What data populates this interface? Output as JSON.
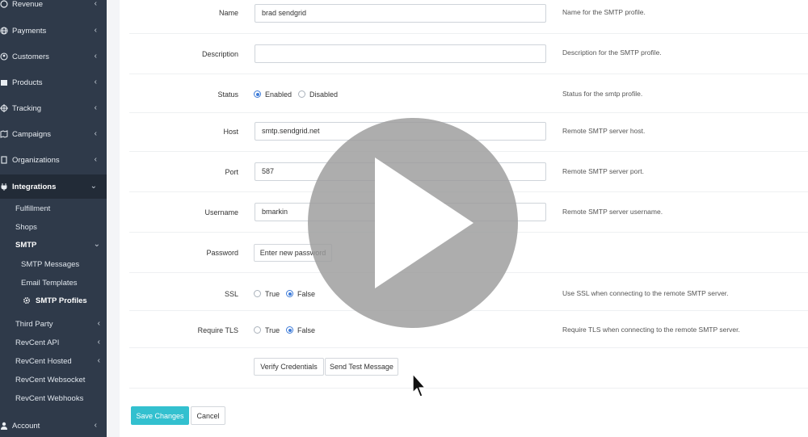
{
  "sidebar": {
    "items": [
      {
        "label": "Revenue",
        "icon": "revenue-icon"
      },
      {
        "label": "Payments",
        "icon": "globe-icon"
      },
      {
        "label": "Customers",
        "icon": "user-circle-icon"
      },
      {
        "label": "Products",
        "icon": "box-icon"
      },
      {
        "label": "Tracking",
        "icon": "crosshair-icon"
      },
      {
        "label": "Campaigns",
        "icon": "map-icon"
      },
      {
        "label": "Organizations",
        "icon": "building-icon"
      },
      {
        "label": "Integrations",
        "icon": "plug-icon"
      }
    ],
    "integrations_sub": [
      "Fulfillment",
      "Shops",
      "SMTP"
    ],
    "smtp_sub": [
      "SMTP Messages",
      "Email Templates",
      "SMTP Profiles"
    ],
    "integrations_more": [
      "Third Party",
      "RevCent API",
      "RevCent Hosted",
      "RevCent Websocket",
      "RevCent Webhooks"
    ],
    "account": "Account"
  },
  "form": {
    "name": {
      "label": "Name",
      "value": "brad sendgrid",
      "help": "Name for the SMTP profile."
    },
    "description": {
      "label": "Description",
      "value": "",
      "help": "Description for the SMTP profile."
    },
    "status": {
      "label": "Status",
      "opt1": "Enabled",
      "opt2": "Disabled",
      "selected": "Enabled",
      "help": "Status for the smtp profile."
    },
    "host": {
      "label": "Host",
      "value": "smtp.sendgrid.net",
      "help": "Remote SMTP server host."
    },
    "port": {
      "label": "Port",
      "value": "587",
      "help": "Remote SMTP server port."
    },
    "username": {
      "label": "Username",
      "value": "bmarkin",
      "help": "Remote SMTP server username."
    },
    "password": {
      "label": "Password",
      "button": "Enter new password"
    },
    "ssl": {
      "label": "SSL",
      "opt1": "True",
      "opt2": "False",
      "selected": "False",
      "help": "Use SSL when connecting to the remote SMTP server."
    },
    "tls": {
      "label": "Require TLS",
      "opt1": "True",
      "opt2": "False",
      "selected": "False",
      "help": "Require TLS when connecting to the remote SMTP server."
    },
    "verify_button": "Verify Credentials",
    "test_button": "Send Test Message"
  },
  "footer": {
    "save": "Save Changes",
    "cancel": "Cancel"
  },
  "colors": {
    "sidebar": "#2f3a4a",
    "accent": "#33c0cf",
    "radio": "#3d7bd8"
  },
  "overlay": {
    "icon": "play-icon"
  }
}
